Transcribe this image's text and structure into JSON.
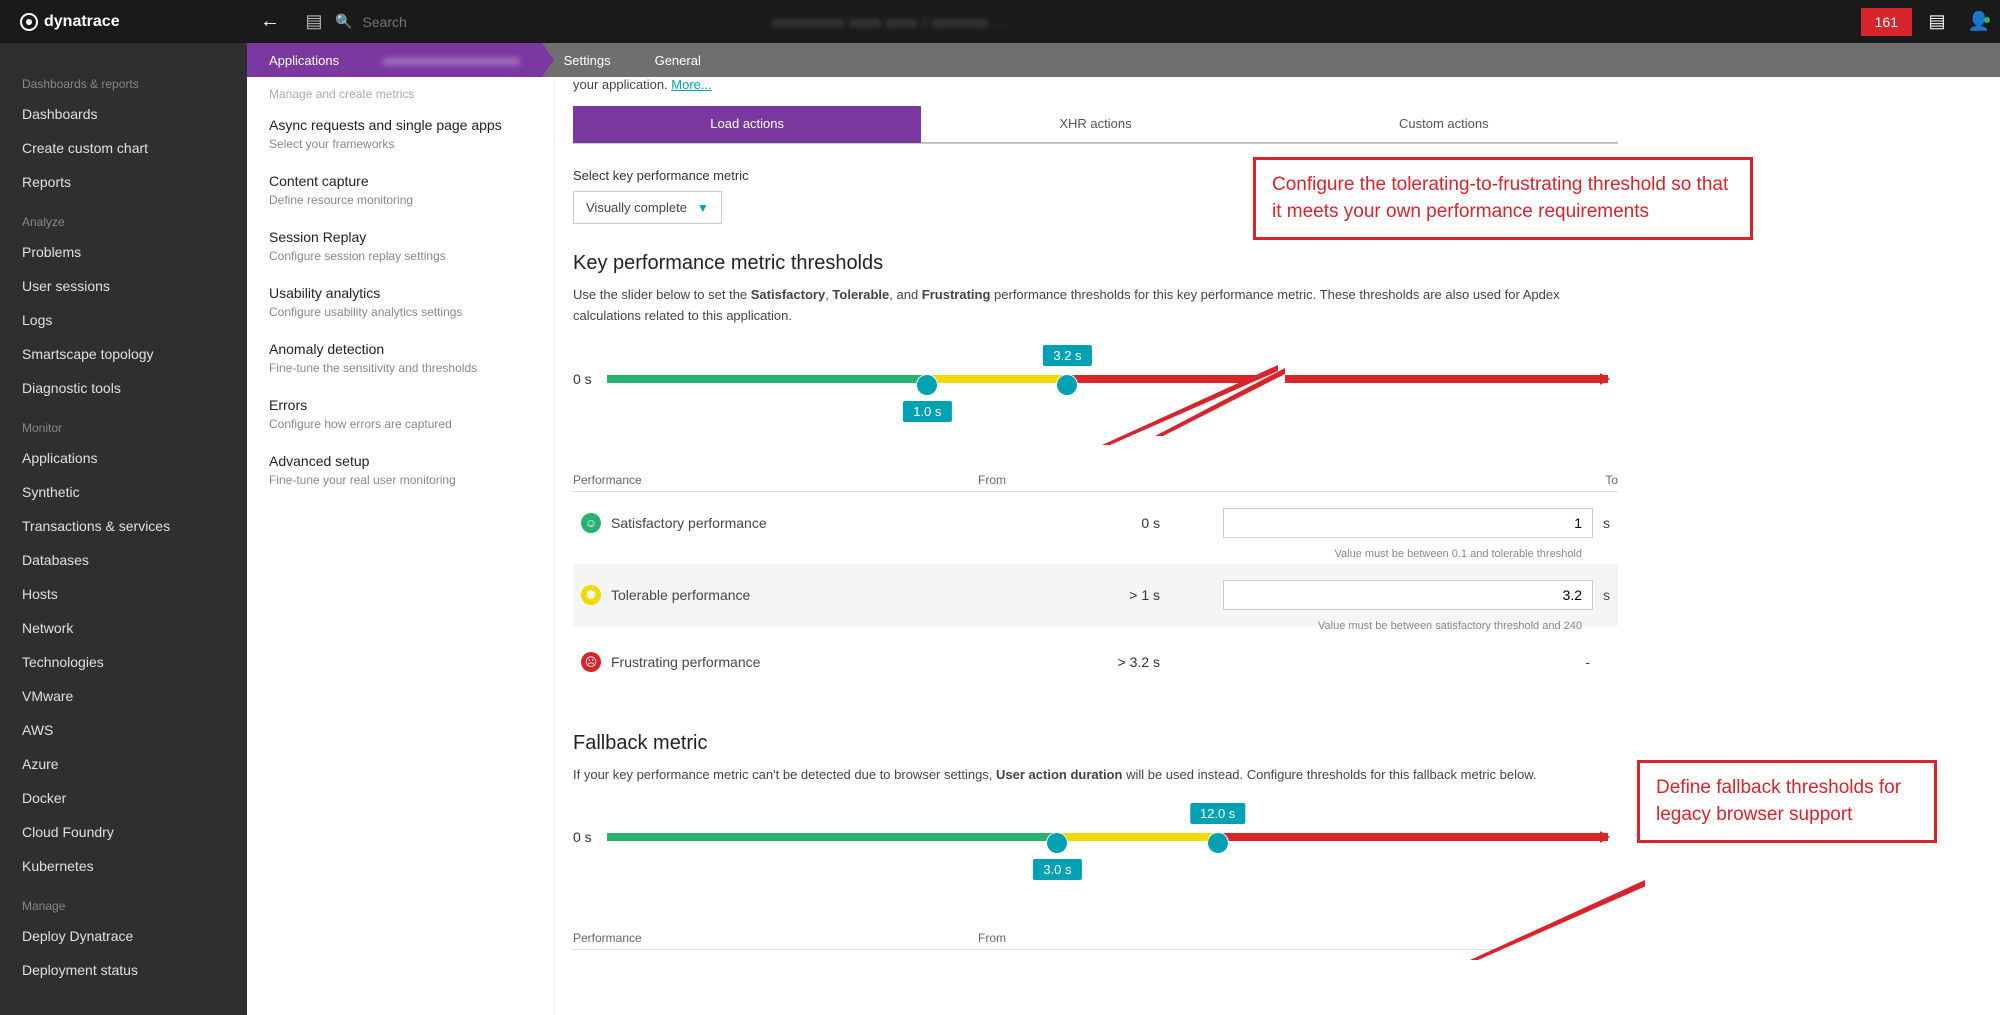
{
  "topbar": {
    "brand": "dynatrace",
    "search_placeholder": "Search",
    "badge": "161"
  },
  "leftnav": {
    "groups": [
      {
        "label": "Dashboards & reports",
        "items": [
          "Dashboards",
          "Create custom chart",
          "Reports"
        ]
      },
      {
        "label": "Analyze",
        "items": [
          "Problems",
          "User sessions",
          "Logs",
          "Smartscape topology",
          "Diagnostic tools"
        ]
      },
      {
        "label": "Monitor",
        "items": [
          "Applications",
          "Synthetic",
          "Transactions & services",
          "Databases",
          "Hosts",
          "Network",
          "Technologies",
          "VMware",
          "AWS",
          "Azure",
          "Docker",
          "Cloud Foundry",
          "Kubernetes"
        ]
      },
      {
        "label": "Manage",
        "items": [
          "Deploy Dynatrace",
          "Deployment status"
        ]
      }
    ]
  },
  "breadcrumb": [
    "Applications",
    "(redacted)",
    "Settings",
    "General"
  ],
  "settings": [
    {
      "title": "Async requests and single page apps",
      "sub": "Select your frameworks"
    },
    {
      "title": "Content capture",
      "sub": "Define resource monitoring"
    },
    {
      "title": "Session Replay",
      "sub": "Configure session replay settings"
    },
    {
      "title": "Usability analytics",
      "sub": "Configure usability analytics settings"
    },
    {
      "title": "Anomaly detection",
      "sub": "Fine-tune the sensitivity and thresholds"
    },
    {
      "title": "Errors",
      "sub": "Configure how errors are captured"
    },
    {
      "title": "Advanced setup",
      "sub": "Fine-tune your real user monitoring"
    }
  ],
  "main": {
    "intro_tail": "your application. ",
    "more": "More...",
    "tabs": [
      "Load actions",
      "XHR actions",
      "Custom actions"
    ],
    "metric_label": "Select key performance metric",
    "metric_value": "Visually complete",
    "h_thresholds": "Key performance metric thresholds",
    "desc_pre": "Use the slider below to set the ",
    "w1": "Satisfactory",
    "w2": "Tolerable",
    "w3": "Frustrating",
    "desc_mid1": ", ",
    "desc_mid2": ", and ",
    "desc_post": " performance thresholds for this key performance metric. These thresholds are also used for Apdex calculations related to this application.",
    "zero": "0 s",
    "slider1": {
      "low": "1.0 s",
      "high": "3.2 s"
    },
    "cols": {
      "c1": "Performance",
      "c2": "From",
      "c3": "To"
    },
    "rows": {
      "sat": {
        "name": "Satisfactory performance",
        "from": "0 s",
        "to": "1",
        "unit": "s",
        "hint": "Value must be between 0.1 and tolerable threshold"
      },
      "tol": {
        "name": "Tolerable performance",
        "from": "> 1 s",
        "to": "3.2",
        "unit": "s",
        "hint": "Value must be between satisfactory threshold and 240"
      },
      "fru": {
        "name": "Frustrating performance",
        "from": "> 3.2 s",
        "to": "-"
      }
    },
    "h_fallback": "Fallback metric",
    "fb_pre": "If your key performance metric can't be detected due to browser settings, ",
    "fb_bold": "User action duration",
    "fb_post": " will be used instead. Configure thresholds for this fallback metric below.",
    "slider2": {
      "low": "3.0 s",
      "high": "12.0 s"
    }
  },
  "callouts": {
    "c1": "Configure the tolerating-to-frustrating threshold so that it meets your own performance requirements",
    "c2": "Define fallback thresholds for legacy browser support"
  }
}
